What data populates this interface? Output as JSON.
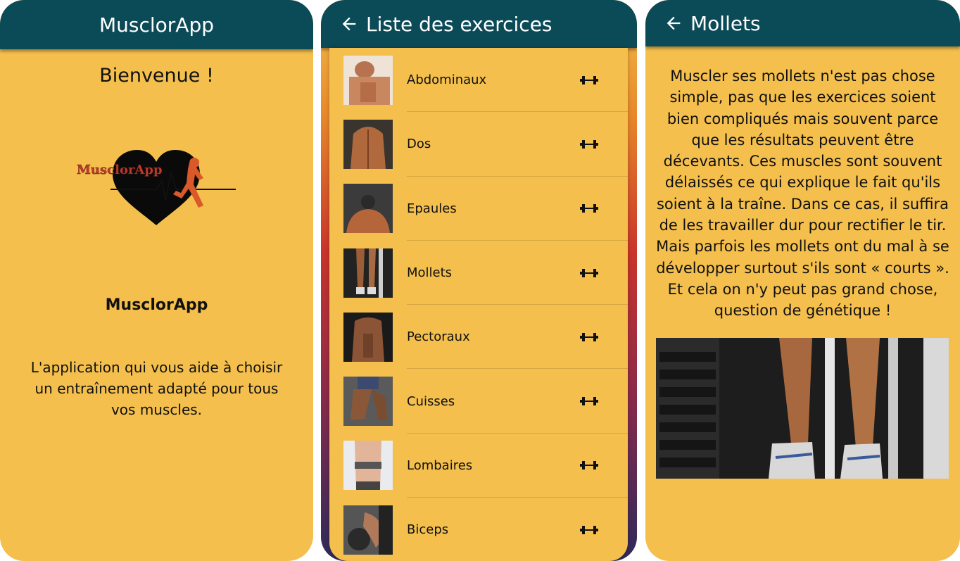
{
  "home": {
    "title": "MusclorApp",
    "welcome": "Bienvenue !",
    "logo_text": "MusclorApp",
    "app_name": "MusclorApp",
    "tagline": "L'application qui vous aide à choisir un entraînement adapté pour tous vos muscles."
  },
  "list": {
    "title": "Liste des exercices",
    "back_icon": "arrow-left-icon",
    "items": [
      {
        "label": "Abdominaux",
        "icon": "dumbbell-icon"
      },
      {
        "label": "Dos",
        "icon": "dumbbell-icon"
      },
      {
        "label": "Epaules",
        "icon": "dumbbell-icon"
      },
      {
        "label": "Mollets",
        "icon": "dumbbell-icon"
      },
      {
        "label": "Pectoraux",
        "icon": "dumbbell-icon"
      },
      {
        "label": "Cuisses",
        "icon": "dumbbell-icon"
      },
      {
        "label": "Lombaires",
        "icon": "dumbbell-icon"
      },
      {
        "label": "Biceps",
        "icon": "dumbbell-icon"
      }
    ]
  },
  "detail": {
    "title": "Mollets",
    "back_icon": "arrow-left-icon",
    "lines": [
      "Muscler ses mollets n'est pas chose",
      "simple, pas que les exercices soient",
      "bien compliqués mais souvent parce",
      "que les résultats peuvent être",
      "décevants. Ces muscles sont souvent",
      "délaissés ce qui explique le fait qu'ils",
      "soient à la traîne. Dans ce cas, il suffira",
      "de les travailler dur pour rectifier le tir.",
      "Mais parfois les mollets ont du mal à se",
      "développer surtout s'ils sont « courts ».",
      "Et cela on n'y peut pas grand chose,",
      "question de génétique !"
    ]
  },
  "colors": {
    "appbar": "#0b4a57",
    "background": "#f4bf4c",
    "text": "#111111"
  }
}
